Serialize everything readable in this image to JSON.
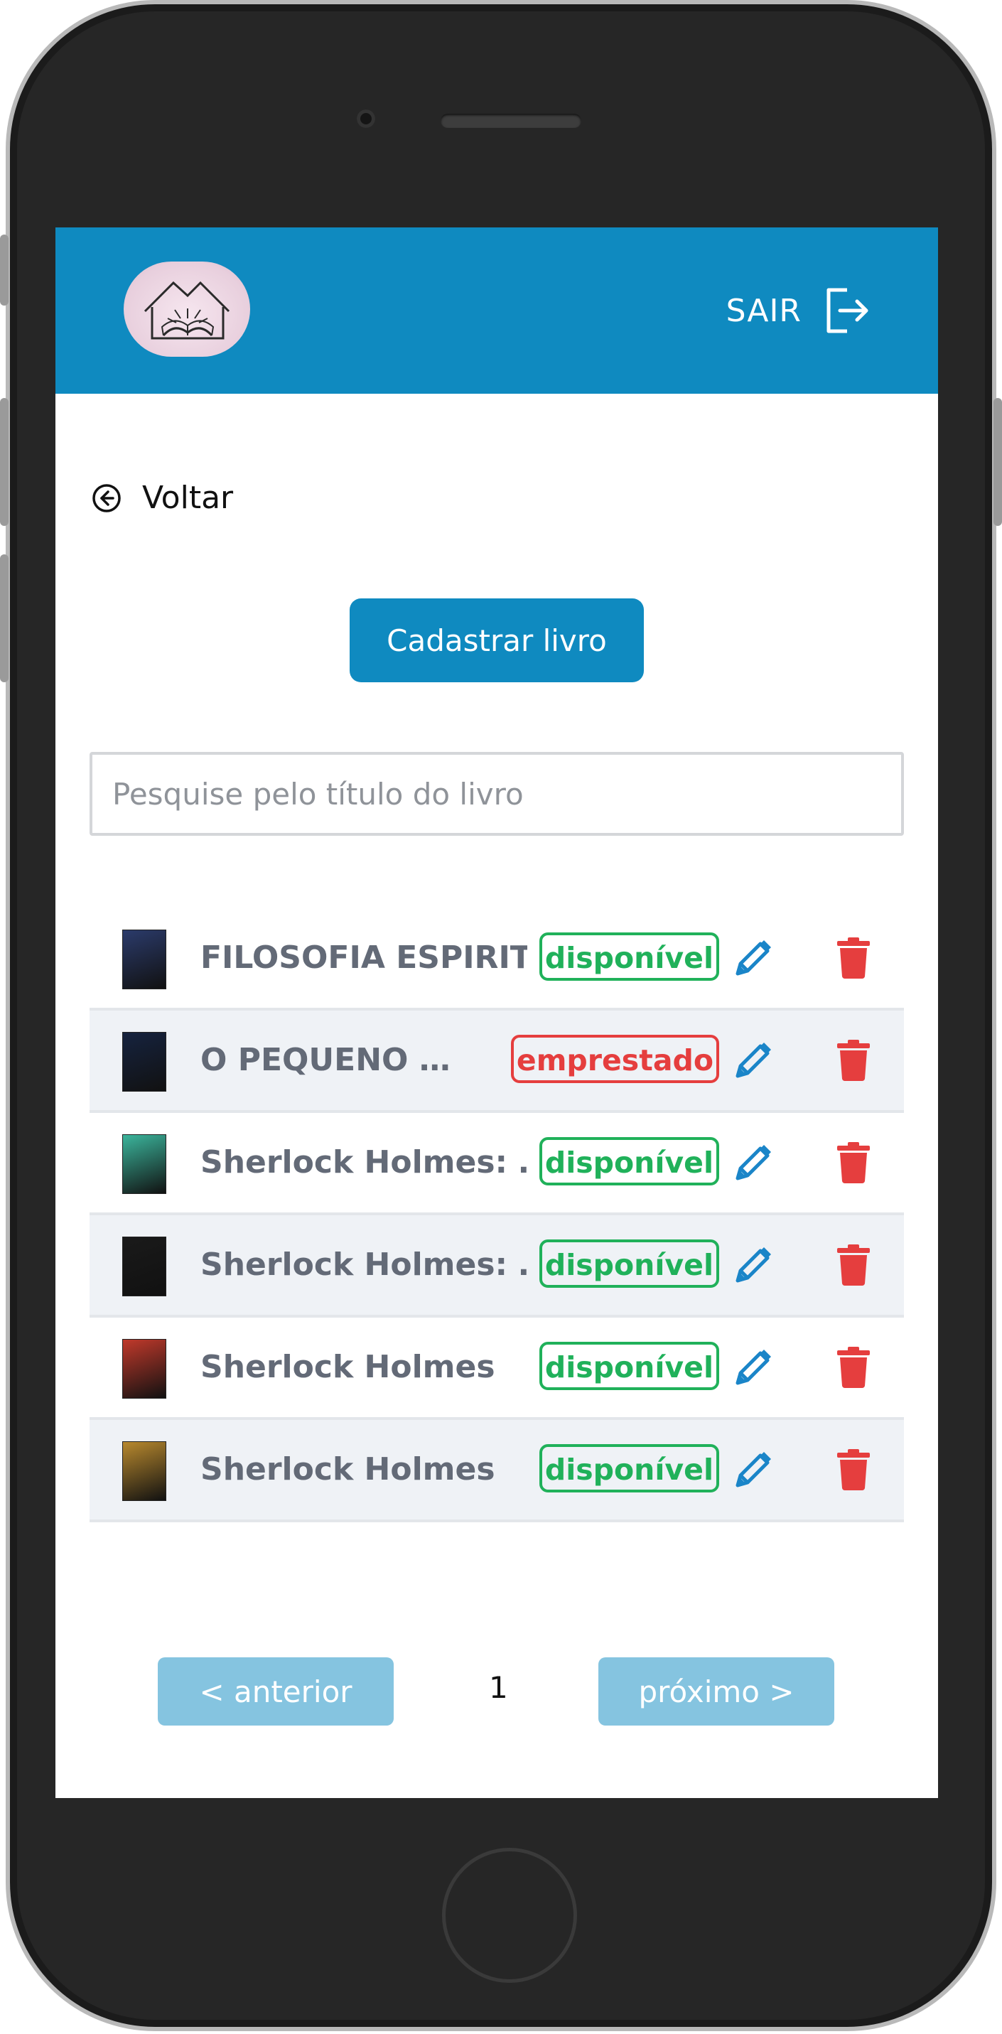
{
  "header": {
    "logout_label": "SAIR"
  },
  "nav": {
    "back_label": "Voltar"
  },
  "actions": {
    "register_label": "Cadastrar livro"
  },
  "search": {
    "placeholder": "Pesquise pelo título do livro",
    "value": ""
  },
  "books": [
    {
      "title": "FILOSOFIA ESPIRIT…",
      "status": "disponível",
      "cover": "#2b3b6b"
    },
    {
      "title": "O PEQUENO …",
      "status": "emprestado",
      "cover": "#16233f"
    },
    {
      "title": "Sherlock Holmes: …",
      "status": "disponível",
      "cover": "#3bb59c"
    },
    {
      "title": "Sherlock Holmes: …",
      "status": "disponível",
      "cover": "#1a1a1a"
    },
    {
      "title": "Sherlock Holmes",
      "status": "disponível",
      "cover": "#c0392b"
    },
    {
      "title": "Sherlock Holmes",
      "status": "disponível",
      "cover": "#b8892e"
    }
  ],
  "pagination": {
    "prev_label": "< anterior",
    "next_label": "próximo >",
    "current_page": "1"
  },
  "colors": {
    "primary": "#0f8ac0",
    "available": "#20b15a",
    "lent": "#e53e3e",
    "edit_icon": "#1a85c8",
    "delete_icon": "#e53e3e",
    "pager_disabled": "#85c4e0"
  }
}
